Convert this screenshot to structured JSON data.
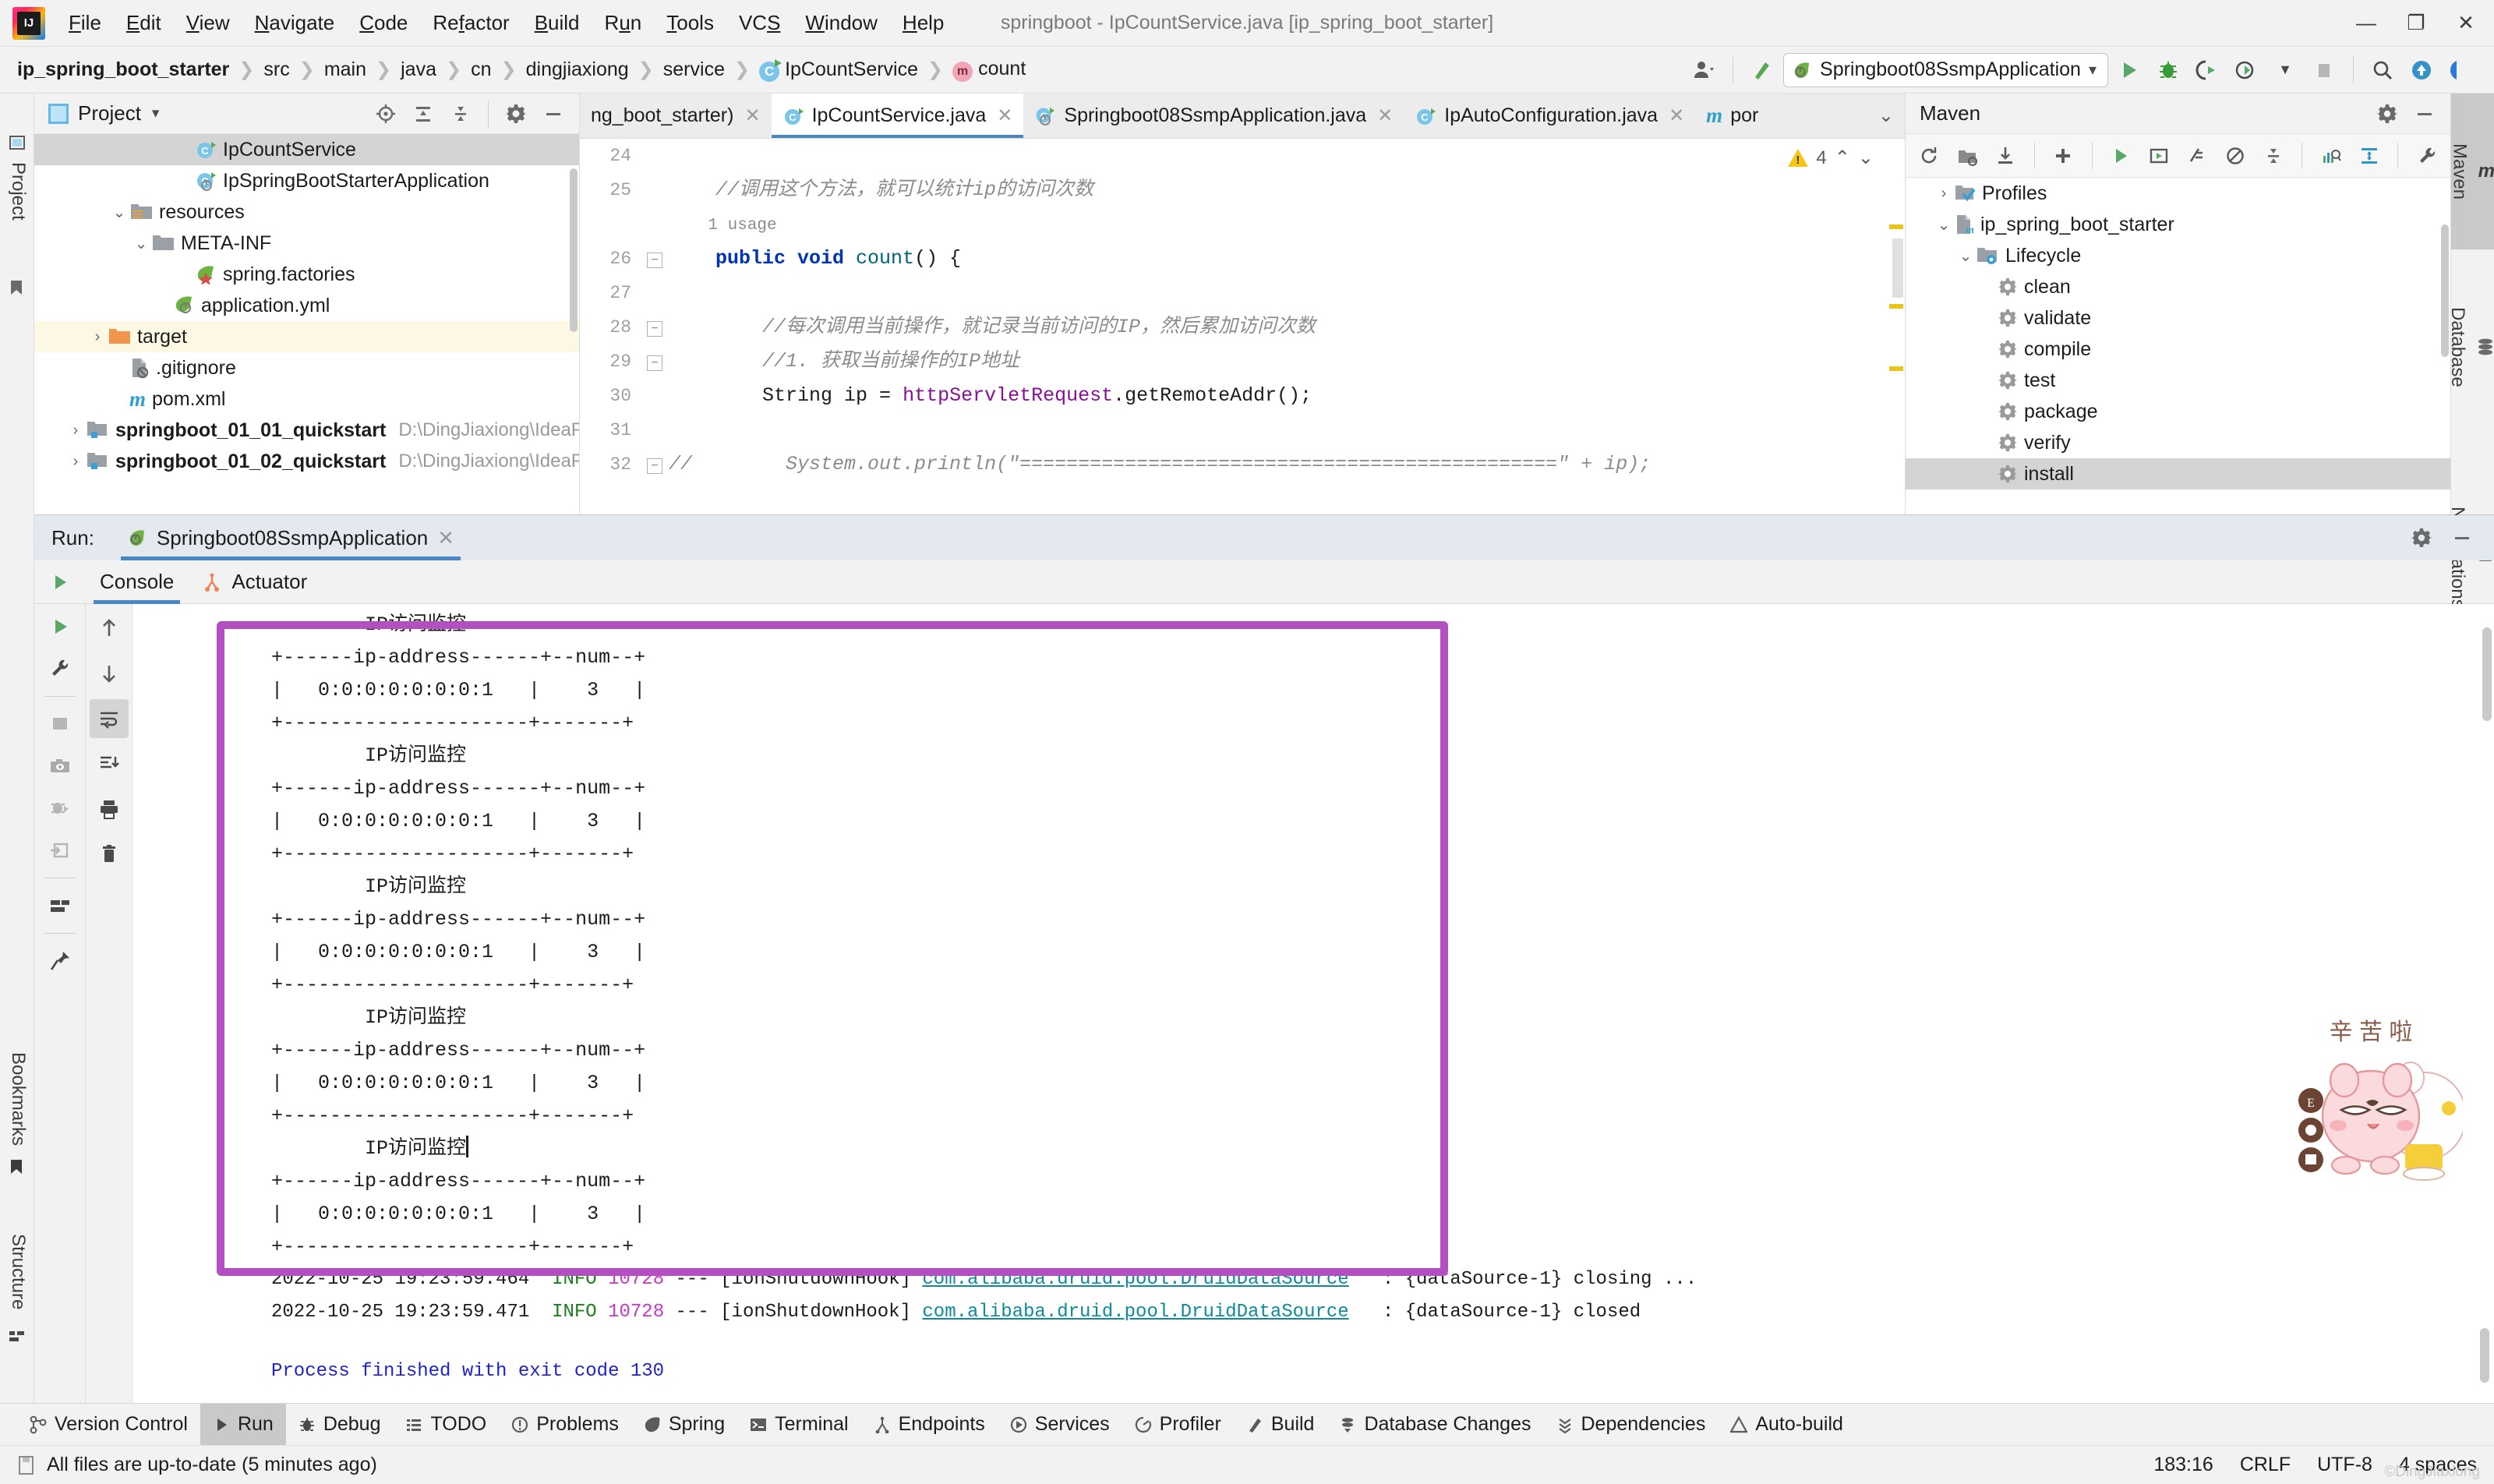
{
  "window": {
    "title": "springboot - IpCountService.java [ip_spring_boot_starter]",
    "minimize": "—",
    "maximize": "❐",
    "close": "✕"
  },
  "menu": [
    "File",
    "Edit",
    "View",
    "Navigate",
    "Code",
    "Refactor",
    "Build",
    "Run",
    "Tools",
    "VCS",
    "Window",
    "Help"
  ],
  "breadcrumb": [
    {
      "label": "ip_spring_boot_starter",
      "icon": "none"
    },
    {
      "label": "src",
      "icon": "none"
    },
    {
      "label": "main",
      "icon": "none"
    },
    {
      "label": "java",
      "icon": "none"
    },
    {
      "label": "cn",
      "icon": "none"
    },
    {
      "label": "dingjiaxiong",
      "icon": "none"
    },
    {
      "label": "service",
      "icon": "none"
    },
    {
      "label": "IpCountService",
      "icon": "class-icon"
    },
    {
      "label": "count",
      "icon": "method-icon"
    }
  ],
  "toolbar": {
    "run_config": "Springboot08SsmpApplication",
    "run_config_caret": "▾",
    "icons": [
      "user-settings-icon",
      "hammer-build-icon",
      "run-icon",
      "debug-icon",
      "run-with-coverage-icon",
      "profile-icon",
      "stop-icon",
      "search-everywhere-icon",
      "update-project-icon",
      "ide-assistant-icon"
    ]
  },
  "left_rail": {
    "project": "Project",
    "bookmarks": "Bookmarks",
    "structure": "Structure"
  },
  "project_panel": {
    "title": "Project",
    "caret": "▾",
    "header_icons": [
      "locate-icon",
      "expand-all-icon",
      "collapse-all-icon",
      "gear-icon",
      "hide-icon"
    ],
    "tree": [
      {
        "label": "IpCountService",
        "icon": "class-icon",
        "indent": 6,
        "chev": "",
        "state": "selected",
        "path": ""
      },
      {
        "label": "IpSpringBootStarterApplication",
        "icon": "class-run-icon",
        "indent": 6,
        "chev": "",
        "state": "",
        "path": ""
      },
      {
        "label": "resources",
        "icon": "resources-folder-icon",
        "indent": 3,
        "chev": "⌄",
        "state": "",
        "path": ""
      },
      {
        "label": "META-INF",
        "icon": "folder-icon",
        "indent": 4,
        "chev": "⌄",
        "state": "",
        "path": ""
      },
      {
        "label": "spring.factories",
        "icon": "spring-factories-icon",
        "indent": 6,
        "chev": "",
        "state": "",
        "path": ""
      },
      {
        "label": "application.yml",
        "icon": "spring-yml-icon",
        "indent": 5,
        "chev": "",
        "state": "",
        "path": ""
      },
      {
        "label": "target",
        "icon": "target-folder-icon",
        "indent": 2,
        "chev": "›",
        "state": "highlight",
        "path": ""
      },
      {
        "label": ".gitignore",
        "icon": "gitignore-icon",
        "indent": 3,
        "chev": "",
        "state": "",
        "path": ""
      },
      {
        "label": "pom.xml",
        "icon": "maven-file-icon",
        "indent": 3,
        "chev": "",
        "state": "",
        "path": ""
      },
      {
        "label": "springboot_01_01_quickstart",
        "icon": "module-folder-icon",
        "indent": 1,
        "chev": "›",
        "state": "bold",
        "path": "D:\\DingJiaxiong\\IdeaP"
      },
      {
        "label": "springboot_01_02_quickstart",
        "icon": "module-folder-icon",
        "indent": 1,
        "chev": "›",
        "state": "bold",
        "path": "D:\\DingJiaxiong\\IdeaP"
      }
    ]
  },
  "editor": {
    "tabs": [
      {
        "label": "ng_boot_starter)",
        "icon": "none",
        "active": false,
        "close": "✕"
      },
      {
        "label": "IpCountService.java",
        "icon": "class-icon",
        "active": true,
        "close": "✕"
      },
      {
        "label": "Springboot08SsmpApplication.java",
        "icon": "spring-class-icon",
        "active": false,
        "close": "✕"
      },
      {
        "label": "IpAutoConfiguration.java",
        "icon": "class-icon",
        "active": false,
        "close": "✕"
      },
      {
        "label": "por",
        "icon": "maven-file-icon",
        "active": false,
        "close": ""
      }
    ],
    "tabs_overflow": "⌄",
    "inspection": {
      "count": "4",
      "up": "⌃",
      "down": "⌄"
    },
    "lines": [
      {
        "num": "24",
        "text": "",
        "kind": "blank"
      },
      {
        "num": "25",
        "text": "//调用这个方法，就可以统计ip的访问次数",
        "kind": "comment"
      },
      {
        "num": "",
        "text": "1 usage",
        "kind": "usage"
      },
      {
        "num": "26",
        "text": "public void count() {",
        "kind": "signature"
      },
      {
        "num": "27",
        "text": "",
        "kind": "blank"
      },
      {
        "num": "28",
        "text": "//每次调用当前操作，就记录当前访问的IP，然后累加访问次数",
        "kind": "comment2"
      },
      {
        "num": "29",
        "text": "//1. 获取当前操作的IP地址",
        "kind": "comment2"
      },
      {
        "num": "30",
        "text": "String ip = httpServletRequest.getRemoteAddr();",
        "kind": "code"
      },
      {
        "num": "31",
        "text": "",
        "kind": "blank"
      },
      {
        "num": "32",
        "text": "//        System.out.println(\"==============================================\" + ip);",
        "kind": "commented-code"
      }
    ]
  },
  "maven_panel": {
    "title": "Maven",
    "header_icons": [
      "gear-icon",
      "hide-icon"
    ],
    "toolbar_icons": [
      "reload-icon",
      "add-maven-project-icon",
      "download-sources-icon",
      "add-icon",
      "run-icon",
      "execute-goal-icon",
      "toggle-skip-tests-icon",
      "toggle-offline-icon",
      "collapse-all-icon",
      "show-dependencies-icon",
      "show-diagram-icon",
      "settings-wrench-icon"
    ],
    "tree": [
      {
        "label": "Profiles",
        "icon": "profiles-icon",
        "indent": 1,
        "chev": "›",
        "state": ""
      },
      {
        "label": "ip_spring_boot_starter",
        "icon": "maven-project-icon",
        "indent": 1,
        "chev": "⌄",
        "state": ""
      },
      {
        "label": "Lifecycle",
        "icon": "lifecycle-folder-icon",
        "indent": 2,
        "chev": "⌄",
        "state": ""
      },
      {
        "label": "clean",
        "icon": "gear-icon",
        "indent": 3,
        "chev": "",
        "state": ""
      },
      {
        "label": "validate",
        "icon": "gear-icon",
        "indent": 3,
        "chev": "",
        "state": ""
      },
      {
        "label": "compile",
        "icon": "gear-icon",
        "indent": 3,
        "chev": "",
        "state": ""
      },
      {
        "label": "test",
        "icon": "gear-icon",
        "indent": 3,
        "chev": "",
        "state": ""
      },
      {
        "label": "package",
        "icon": "gear-icon",
        "indent": 3,
        "chev": "",
        "state": ""
      },
      {
        "label": "verify",
        "icon": "gear-icon",
        "indent": 3,
        "chev": "",
        "state": ""
      },
      {
        "label": "install",
        "icon": "gear-icon",
        "indent": 3,
        "chev": "",
        "state": "selected"
      }
    ]
  },
  "right_rail": [
    {
      "label": "Maven",
      "icon": "maven-m-icon",
      "selected": true
    },
    {
      "label": "Database",
      "icon": "database-icon",
      "selected": false
    },
    {
      "label": "Notifications",
      "icon": "bell-icon",
      "selected": false
    }
  ],
  "run_panel": {
    "run_label": "Run:",
    "session_tab": "Springboot08SsmpApplication",
    "session_close": "✕",
    "header_icons": [
      "gear-icon",
      "hide-icon"
    ],
    "console_tabs": [
      {
        "label": "Console",
        "icon": "none",
        "active": true
      },
      {
        "label": "Actuator",
        "icon": "actuator-icon",
        "active": false
      }
    ],
    "run_tool_icons": [
      "rerun-icon",
      "edit-configuration-icon",
      "stop-icon",
      "screenshot-icon",
      "thread-dump-icon",
      "attach-icon",
      "layout-icon",
      "pin-icon"
    ],
    "console_tool_icons": [
      "scroll-up-icon",
      "scroll-down-icon",
      "soft-wrap-icon",
      "scroll-to-end-icon",
      "print-icon",
      "clear-all-icon"
    ],
    "console_lines": [
      {
        "text": "        IP访问监控",
        "style": "plain"
      },
      {
        "text": "+------ip-address------+--num--+",
        "style": "plain"
      },
      {
        "text": "|   0:0:0:0:0:0:0:1   |    3   |",
        "style": "plain"
      },
      {
        "text": "+---------------------+-------+",
        "style": "plain"
      },
      {
        "text": "        IP访问监控",
        "style": "plain"
      },
      {
        "text": "+------ip-address------+--num--+",
        "style": "plain"
      },
      {
        "text": "|   0:0:0:0:0:0:0:1   |    3   |",
        "style": "plain"
      },
      {
        "text": "+---------------------+-------+",
        "style": "plain"
      },
      {
        "text": "        IP访问监控",
        "style": "plain"
      },
      {
        "text": "+------ip-address------+--num--+",
        "style": "plain"
      },
      {
        "text": "|   0:0:0:0:0:0:0:1   |    3   |",
        "style": "plain"
      },
      {
        "text": "+---------------------+-------+",
        "style": "plain"
      },
      {
        "text": "        IP访问监控",
        "style": "plain"
      },
      {
        "text": "+------ip-address------+--num--+",
        "style": "plain"
      },
      {
        "text": "|   0:0:0:0:0:0:0:1   |    3   |",
        "style": "plain"
      },
      {
        "text": "+---------------------+-------+",
        "style": "plain"
      },
      {
        "text": "        IP访问监控",
        "style": "caret"
      },
      {
        "text": "+------ip-address------+--num--+",
        "style": "plain"
      },
      {
        "text": "|   0:0:0:0:0:0:0:1   |    3   |",
        "style": "plain"
      },
      {
        "text": "+---------------------+-------+",
        "style": "plain"
      }
    ],
    "log_lines": [
      {
        "timestamp": "2022-10-25 19:23:59.464",
        "level": "INFO",
        "pid": "10728",
        "dashes": "---",
        "thread": "[ionShutdownHook]",
        "logger": "com.alibaba.druid.pool.DruidDataSource",
        "message": ": {dataSource-1} closing ..."
      },
      {
        "timestamp": "2022-10-25 19:23:59.471",
        "level": "INFO",
        "pid": "10728",
        "dashes": "---",
        "thread": "[ionShutdownHook]",
        "logger": "com.alibaba.druid.pool.DruidDataSource",
        "message": ": {dataSource-1} closed"
      }
    ],
    "exit_line": "Process finished with exit code 130",
    "mascot_text": "辛苦啦"
  },
  "toolwindow_bar": [
    {
      "label": "Version Control",
      "icon": "vcs-icon",
      "selected": false
    },
    {
      "label": "Run",
      "icon": "run-icon",
      "selected": true
    },
    {
      "label": "Debug",
      "icon": "debug-icon",
      "selected": false
    },
    {
      "label": "TODO",
      "icon": "todo-icon",
      "selected": false
    },
    {
      "label": "Problems",
      "icon": "problems-icon",
      "selected": false
    },
    {
      "label": "Spring",
      "icon": "spring-icon",
      "selected": false
    },
    {
      "label": "Terminal",
      "icon": "terminal-icon",
      "selected": false
    },
    {
      "label": "Endpoints",
      "icon": "endpoints-icon",
      "selected": false
    },
    {
      "label": "Services",
      "icon": "services-icon",
      "selected": false
    },
    {
      "label": "Profiler",
      "icon": "profiler-icon",
      "selected": false
    },
    {
      "label": "Build",
      "icon": "build-icon",
      "selected": false
    },
    {
      "label": "Database Changes",
      "icon": "database-changes-icon",
      "selected": false
    },
    {
      "label": "Dependencies",
      "icon": "dependencies-icon",
      "selected": false
    },
    {
      "label": "Auto-build",
      "icon": "auto-build-icon",
      "selected": false
    }
  ],
  "statusbar": {
    "message": "All files are up-to-date (5 minutes ago)",
    "caret_position": "183:16",
    "line_separator": "CRLF",
    "encoding": "UTF-8",
    "indent": "4 spaces",
    "watermark": "©DingJiaxiong"
  },
  "colors": {
    "accent_blue": "#4a86c5",
    "highlight_purple": "#b34fc0",
    "keyword_blue": "#0033b3",
    "field_purple": "#871094",
    "method_teal": "#00627a",
    "comment_gray": "#8c8c8c",
    "warning_yellow": "#f5c518",
    "selection_gray": "#d4d4d4"
  }
}
